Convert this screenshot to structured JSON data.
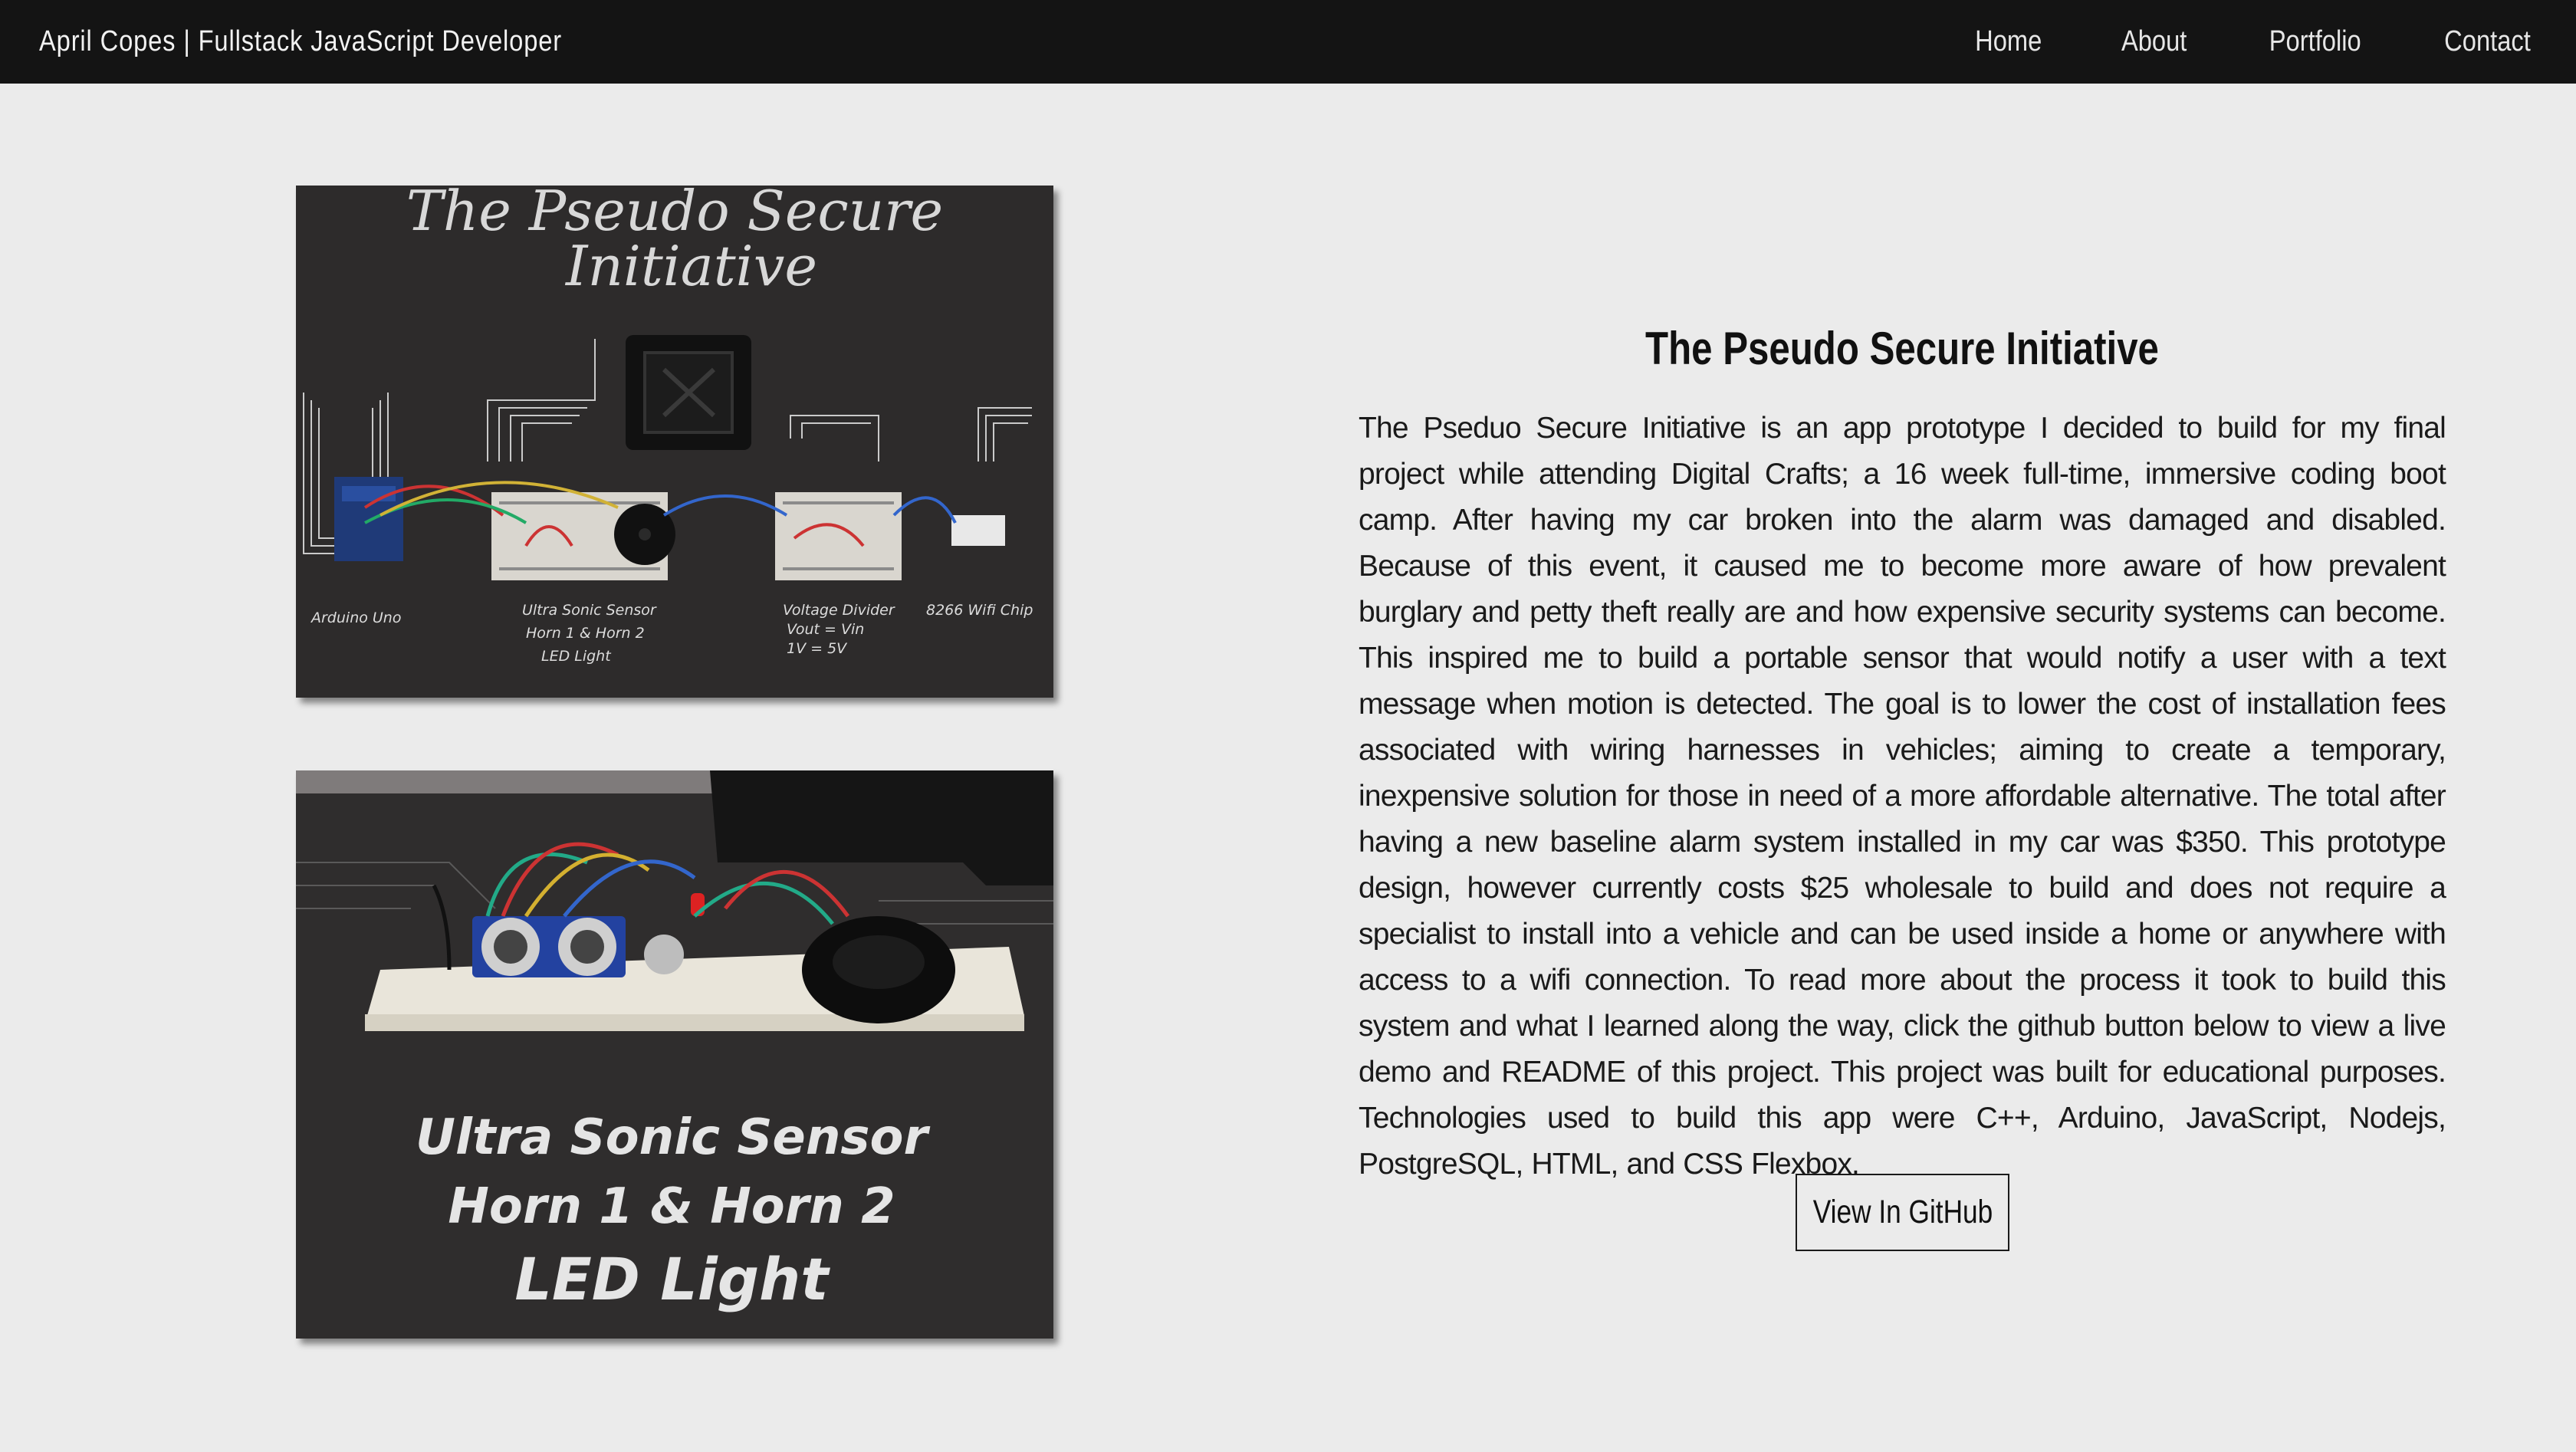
{
  "nav": {
    "brand": "April Copes | Fullstack JavaScript Developer",
    "links": [
      "Home",
      "About",
      "Portfolio",
      "Contact"
    ]
  },
  "images": {
    "diagram": {
      "title_line1": "The Pseudo Secure",
      "title_line2": "Initiative",
      "labels": [
        "Arduino Uno",
        "Ultra Sonic Sensor",
        "Horn 1 & Horn 2",
        "LED Light",
        "Voltage Divider",
        "Vout = Vin",
        "1V = 5V",
        "8266 Wifi Chip"
      ]
    },
    "breadboard": {
      "line1": "Ultra Sonic Sensor",
      "line2": "Horn 1 & Horn 2",
      "line3": "LED Light"
    }
  },
  "project": {
    "title": "The Pseudo Secure Initiative",
    "description": "The Pseduo Secure Initiative is an app prototype I decided to build for my final project while attending Digital Crafts; a 16 week full-time, immersive coding boot camp. After having my car broken into the alarm was damaged and disabled. Because of this event, it caused me to become more aware of how prevalent burglary and petty theft really are and how expensive security systems can become. This inspired me to build a portable sensor that would notify a user with a text message when motion is detected. The goal is to lower the cost of installation fees associated with wiring harnesses in vehicles; aiming to create a temporary, inexpensive solution for those in need of a more affordable alternative. The total after having a new baseline alarm system installed in my car was $350. This prototype design, however currently costs $25 wholesale to build and does not require a specialist to install into a vehicle and can be used inside a home or anywhere with access to a wifi connection. To read more about the process it took to build this system and what I learned along the way, click the github button below to view a live demo and README of this project. This project was built for educational purposes. Technologies used to build this app were C++, Arduino, JavaScript, Nodejs, PostgreSQL, HTML, and CSS Flexbox.",
    "button_label": "View In GitHub"
  },
  "colors": {
    "navbar_bg": "#141414",
    "page_bg": "#ebebeb",
    "chalkboard": "#2c2a2a"
  }
}
